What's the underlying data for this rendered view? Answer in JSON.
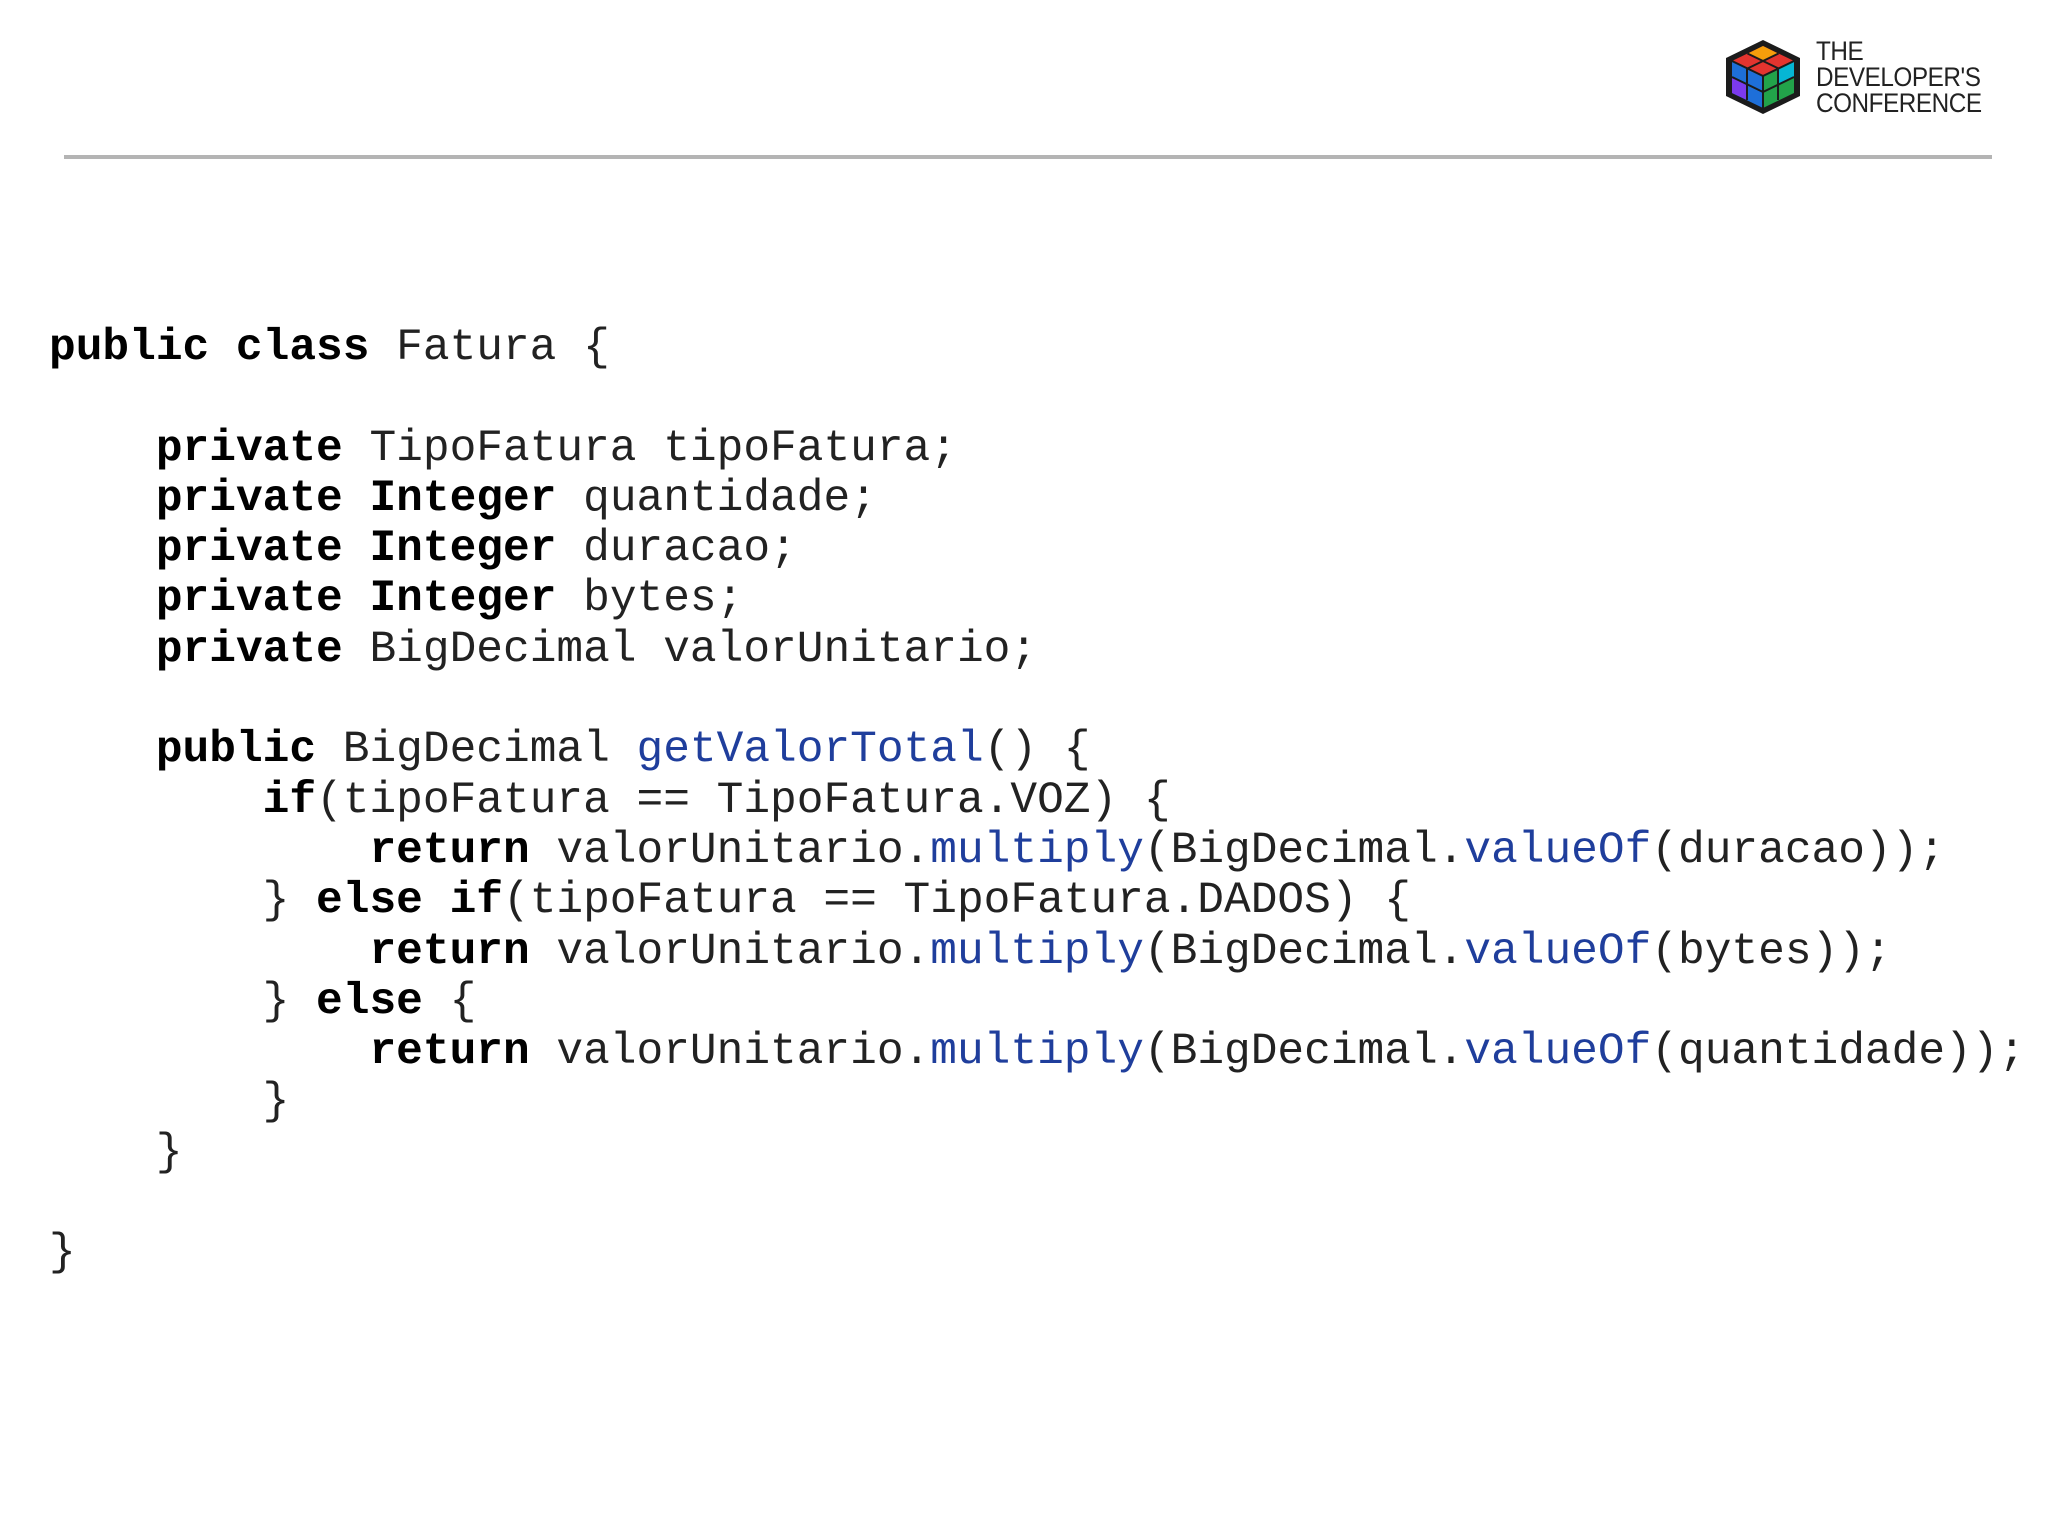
{
  "logo": {
    "lines": [
      "THE",
      "DEVELOPER'S",
      "CONFERENCE"
    ],
    "colors": [
      "#e3342f",
      "#f59e0b",
      "#22a34a",
      "#1e6fd9",
      "#7c3aed",
      "#06b6d4"
    ]
  },
  "code": {
    "lines": [
      [
        {
          "t": "public class",
          "s": "kw"
        },
        {
          "t": " Fatura {",
          "s": ""
        }
      ],
      [],
      [
        {
          "t": "    ",
          "s": ""
        },
        {
          "t": "private",
          "s": "kw"
        },
        {
          "t": " TipoFatura tipoFatura;",
          "s": ""
        }
      ],
      [
        {
          "t": "    ",
          "s": ""
        },
        {
          "t": "private Integer",
          "s": "kw"
        },
        {
          "t": " quantidade;",
          "s": ""
        }
      ],
      [
        {
          "t": "    ",
          "s": ""
        },
        {
          "t": "private Integer",
          "s": "kw"
        },
        {
          "t": " duracao;",
          "s": ""
        }
      ],
      [
        {
          "t": "    ",
          "s": ""
        },
        {
          "t": "private Integer",
          "s": "kw"
        },
        {
          "t": " bytes;",
          "s": ""
        }
      ],
      [
        {
          "t": "    ",
          "s": ""
        },
        {
          "t": "private",
          "s": "kw"
        },
        {
          "t": " BigDecimal valorUnitario;",
          "s": ""
        }
      ],
      [],
      [
        {
          "t": "    ",
          "s": ""
        },
        {
          "t": "public",
          "s": "kw"
        },
        {
          "t": " BigDecimal ",
          "s": ""
        },
        {
          "t": "getValorTotal",
          "s": "fn"
        },
        {
          "t": "() {",
          "s": ""
        }
      ],
      [
        {
          "t": "        ",
          "s": ""
        },
        {
          "t": "if",
          "s": "kw"
        },
        {
          "t": "(tipoFatura == TipoFatura.VOZ) {",
          "s": ""
        }
      ],
      [
        {
          "t": "            ",
          "s": ""
        },
        {
          "t": "return",
          "s": "kw"
        },
        {
          "t": " valorUnitario.",
          "s": ""
        },
        {
          "t": "multiply",
          "s": "fn"
        },
        {
          "t": "(BigDecimal.",
          "s": ""
        },
        {
          "t": "valueOf",
          "s": "fn"
        },
        {
          "t": "(duracao));",
          "s": ""
        }
      ],
      [
        {
          "t": "        } ",
          "s": ""
        },
        {
          "t": "else if",
          "s": "kw"
        },
        {
          "t": "(tipoFatura == TipoFatura.DADOS) {",
          "s": ""
        }
      ],
      [
        {
          "t": "            ",
          "s": ""
        },
        {
          "t": "return",
          "s": "kw"
        },
        {
          "t": " valorUnitario.",
          "s": ""
        },
        {
          "t": "multiply",
          "s": "fn"
        },
        {
          "t": "(BigDecimal.",
          "s": ""
        },
        {
          "t": "valueOf",
          "s": "fn"
        },
        {
          "t": "(bytes));",
          "s": ""
        }
      ],
      [
        {
          "t": "        } ",
          "s": ""
        },
        {
          "t": "else",
          "s": "kw"
        },
        {
          "t": " {",
          "s": ""
        }
      ],
      [
        {
          "t": "            ",
          "s": ""
        },
        {
          "t": "return",
          "s": "kw"
        },
        {
          "t": " valorUnitario.",
          "s": ""
        },
        {
          "t": "multiply",
          "s": "fn"
        },
        {
          "t": "(BigDecimal.",
          "s": ""
        },
        {
          "t": "valueOf",
          "s": "fn"
        },
        {
          "t": "(quantidade));",
          "s": ""
        }
      ],
      [
        {
          "t": "        }",
          "s": ""
        }
      ],
      [
        {
          "t": "    }",
          "s": ""
        }
      ],
      [],
      [
        {
          "t": "}",
          "s": ""
        }
      ]
    ]
  }
}
